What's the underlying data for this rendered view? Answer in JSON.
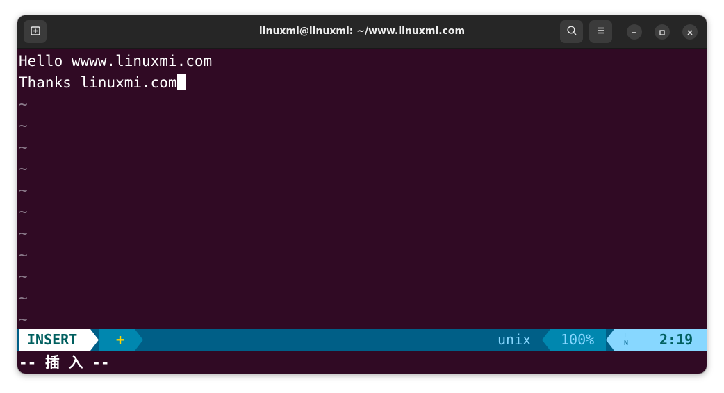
{
  "window": {
    "title": "linuxmi@linuxmi: ~/www.linuxmi.com",
    "buttons": {
      "new_tab_icon": "new-tab-icon",
      "search_icon": "search-icon",
      "menu_icon": "hamburger-menu-icon",
      "minimize_icon": "minimize-icon",
      "maximize_icon": "maximize-icon",
      "close_icon": "close-icon"
    }
  },
  "editor": {
    "lines": [
      "Hello wwww.linuxmi.com",
      "Thanks linuxmi.com"
    ],
    "tilde": "~"
  },
  "statusline": {
    "mode": "INSERT",
    "modified": "+",
    "fileformat": "unix",
    "percent": "100%",
    "ln_symbol": "LN",
    "position": "2:19",
    "colors": {
      "bar": "#005f87",
      "mode_bg": "#ffffff",
      "mode_fg": "#005f5f",
      "modified_fg": "#ffd700",
      "percent_bg": "#0087af",
      "position_bg": "#87d7ff"
    }
  },
  "cmdline": {
    "message": "-- 插 入 --"
  }
}
